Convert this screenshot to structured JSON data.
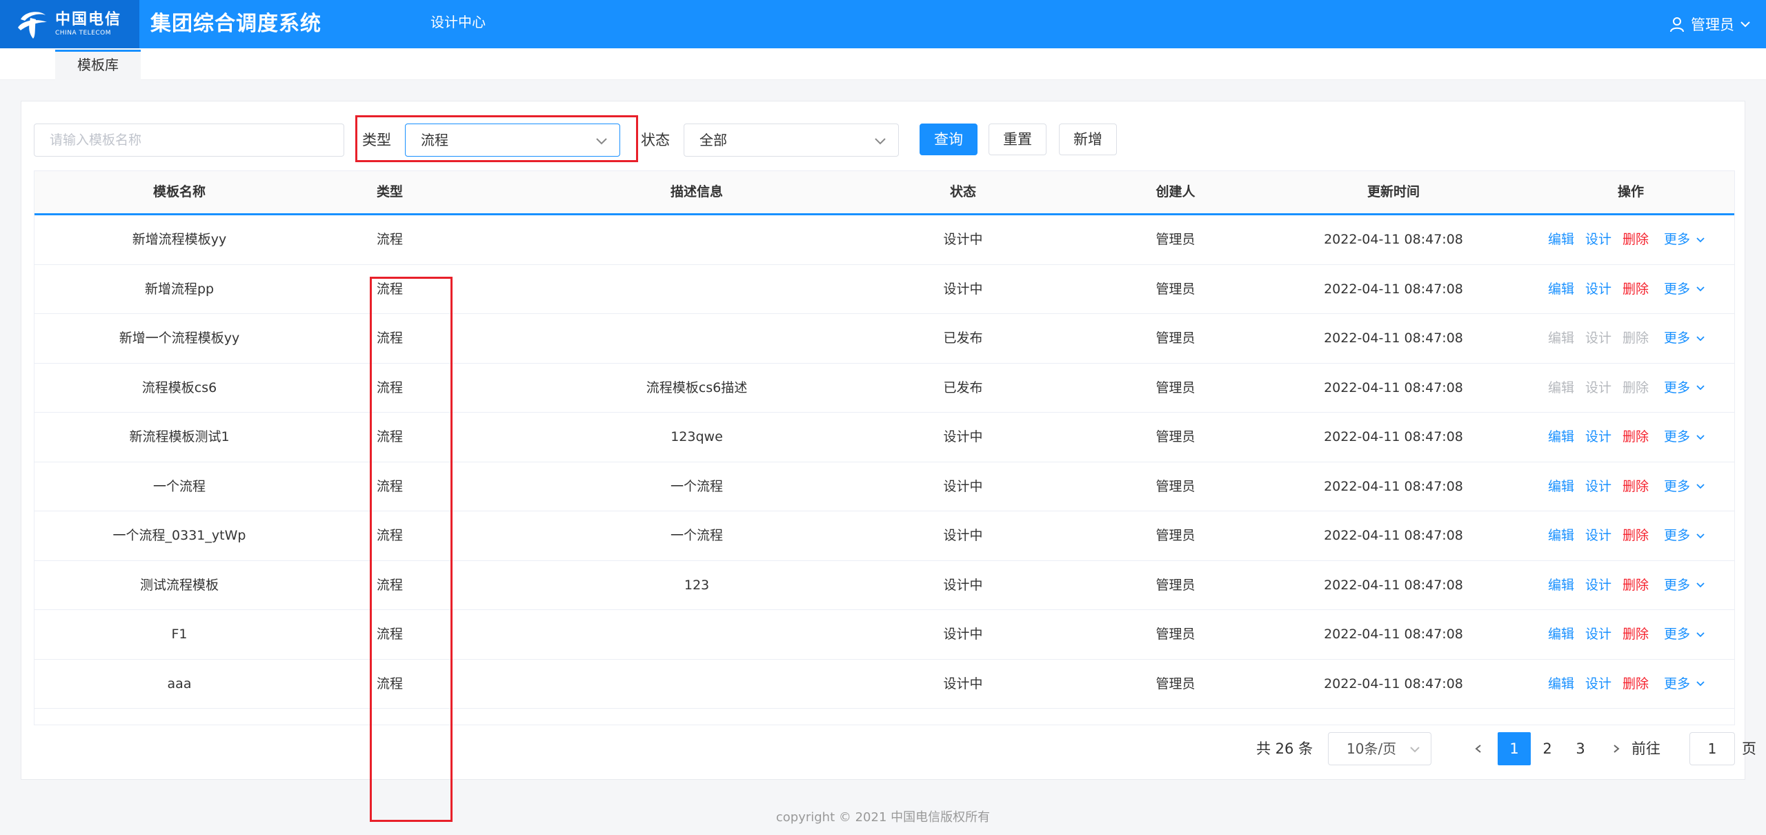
{
  "header": {
    "logo_cn": "中国电信",
    "logo_en": "CHINA TELECOM",
    "system_title": "集团综合调度系统",
    "nav_item": "设计中心",
    "user": "管理员"
  },
  "tabs": [
    "模板库"
  ],
  "filters": {
    "name_placeholder": "请输入模板名称",
    "type_label": "类型",
    "type_value": "流程",
    "status_label": "状态",
    "status_value": "全部",
    "query_button": "查询",
    "reset_button": "重置",
    "add_button": "新增"
  },
  "table": {
    "columns": [
      "模板名称",
      "类型",
      "描述信息",
      "状态",
      "创建人",
      "更新时间",
      "操作"
    ],
    "rows": [
      {
        "name": "新增流程模板yy",
        "type": "流程",
        "desc": "",
        "status": "设计中",
        "creator": "管理员",
        "updated": "2022-04-11 08:47:08",
        "enabled": true
      },
      {
        "name": "新增流程pp",
        "type": "流程",
        "desc": "",
        "status": "设计中",
        "creator": "管理员",
        "updated": "2022-04-11 08:47:08",
        "enabled": true
      },
      {
        "name": "新增一个流程模板yy",
        "type": "流程",
        "desc": "",
        "status": "已发布",
        "creator": "管理员",
        "updated": "2022-04-11 08:47:08",
        "enabled": false
      },
      {
        "name": "流程模板cs6",
        "type": "流程",
        "desc": "流程模板cs6描述",
        "status": "已发布",
        "creator": "管理员",
        "updated": "2022-04-11 08:47:08",
        "enabled": false
      },
      {
        "name": "新流程模板测试1",
        "type": "流程",
        "desc": "123qwe",
        "status": "设计中",
        "creator": "管理员",
        "updated": "2022-04-11 08:47:08",
        "enabled": true
      },
      {
        "name": "一个流程",
        "type": "流程",
        "desc": "一个流程",
        "status": "设计中",
        "creator": "管理员",
        "updated": "2022-04-11 08:47:08",
        "enabled": true
      },
      {
        "name": "一个流程_0331_ytWp",
        "type": "流程",
        "desc": "一个流程",
        "status": "设计中",
        "creator": "管理员",
        "updated": "2022-04-11 08:47:08",
        "enabled": true
      },
      {
        "name": "测试流程模板",
        "type": "流程",
        "desc": "123",
        "status": "设计中",
        "creator": "管理员",
        "updated": "2022-04-11 08:47:08",
        "enabled": true
      },
      {
        "name": "F1",
        "type": "流程",
        "desc": "",
        "status": "设计中",
        "creator": "管理员",
        "updated": "2022-04-11 08:47:08",
        "enabled": true
      },
      {
        "name": "aaa",
        "type": "流程",
        "desc": "",
        "status": "设计中",
        "creator": "管理员",
        "updated": "2022-04-11 08:47:08",
        "enabled": true
      }
    ],
    "actions": {
      "edit": "编辑",
      "design": "设计",
      "delete": "删除",
      "more": "更多"
    }
  },
  "pagination": {
    "total": "共 26 条",
    "page_size": "10条/页",
    "pages": [
      "1",
      "2",
      "3"
    ],
    "current": "1",
    "goto_label": "前往",
    "goto_value": "1",
    "goto_suffix": "页"
  },
  "footer": "copyright © 2021 中国电信版权所有",
  "colors": {
    "primary": "#1890ff",
    "header_logo_bg": "#0d6fd8",
    "danger": "#f5222d",
    "highlight_box": "#e8202a",
    "disabled": "#b5b8bd"
  }
}
